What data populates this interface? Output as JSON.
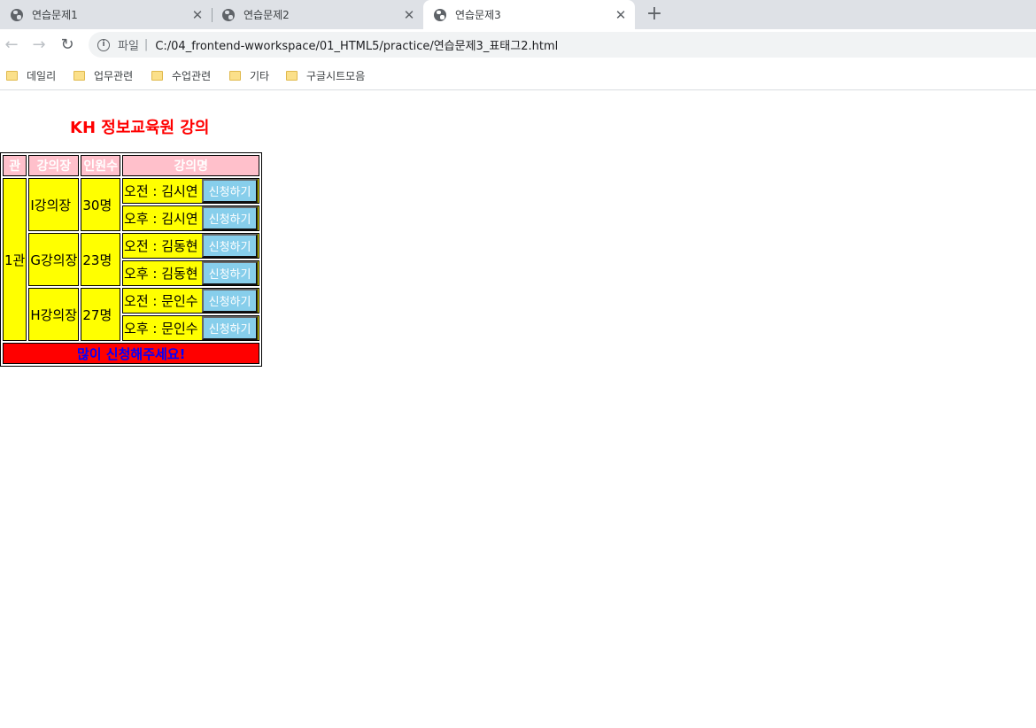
{
  "browser": {
    "tabs": [
      {
        "title": "연습문제1",
        "close": "✕"
      },
      {
        "title": "연습문제2",
        "close": "✕"
      },
      {
        "title": "연습문제3",
        "close": "✕"
      }
    ],
    "new_tab": "+",
    "nav": {
      "back": "←",
      "forward": "→",
      "reload": "↻"
    },
    "address": {
      "scheme_label": "파일",
      "separator": "|",
      "url": "C:/04_frontend-wworkspace/01_HTML5/practice/연습문제3_표태그2.html",
      "info": "i"
    },
    "bookmarks": [
      "데일리",
      "업무관련",
      "수업관련",
      "기타",
      "구글시트모음"
    ]
  },
  "page": {
    "heading": "KH 정보교육원 강의",
    "table": {
      "headers": [
        "관",
        "강의장",
        "인원수",
        "강의명"
      ],
      "hall": "1관",
      "rooms": [
        {
          "name": "I강의장",
          "count": "30명",
          "sessions": [
            "오전 : 김시연",
            "오후 : 김시연"
          ]
        },
        {
          "name": "G강의장",
          "count": "23명",
          "sessions": [
            "오전 : 김동현",
            "오후 : 김동현"
          ]
        },
        {
          "name": "H강의장",
          "count": "27명",
          "sessions": [
            "오전 : 문인수",
            "오후 : 문인수"
          ]
        }
      ],
      "apply_label": "신청하기",
      "footer": "많이 신청해주세요!"
    }
  },
  "colors": {
    "heading": "#ff0000",
    "header_bg": "#ffc0cb",
    "cell_bg": "#ffff00",
    "button_bg": "#87ceeb",
    "footer_bg": "#ff0000",
    "footer_text": "#0000ff"
  }
}
